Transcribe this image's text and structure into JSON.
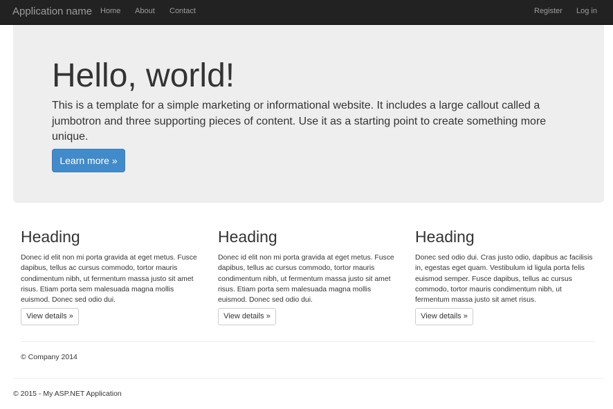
{
  "navbar": {
    "brand": "Application name",
    "links": [
      "Home",
      "About",
      "Contact"
    ],
    "right_links": [
      "Register",
      "Log in"
    ]
  },
  "jumbotron": {
    "title": "Hello, world!",
    "lead": "This is a template for a simple marketing or informational website. It includes a large callout called a jumbotron and three supporting pieces of content. Use it as a starting point to create something more unique.",
    "button_label": "Learn more »"
  },
  "columns": [
    {
      "heading": "Heading",
      "body": "Donec id elit non mi porta gravida at eget metus. Fusce dapibus, tellus ac cursus commodo, tortor mauris condimentum nibh, ut fermentum massa justo sit amet risus. Etiam porta sem malesuada magna mollis euismod. Donec sed odio dui.",
      "button_label": "View details »"
    },
    {
      "heading": "Heading",
      "body": "Donec id elit non mi porta gravida at eget metus. Fusce dapibus, tellus ac cursus commodo, tortor mauris condimentum nibh, ut fermentum massa justo sit amet risus. Etiam porta sem malesuada magna mollis euismod. Donec sed odio dui.",
      "button_label": "View details »"
    },
    {
      "heading": "Heading",
      "body": "Donec sed odio dui. Cras justo odio, dapibus ac facilisis in, egestas eget quam. Vestibulum id ligula porta felis euismod semper. Fusce dapibus, tellus ac cursus commodo, tortor mauris condimentum nibh, ut fermentum massa justo sit amet risus.",
      "button_label": "View details »"
    }
  ],
  "inner_footer": "© Company 2014",
  "outer_footer": "© 2015 - My ASP.NET Application",
  "colors": {
    "navbar_bg": "#222222",
    "navbar_text": "#9d9d9d",
    "jumbotron_bg": "#eeeeee",
    "primary": "#428bca"
  }
}
